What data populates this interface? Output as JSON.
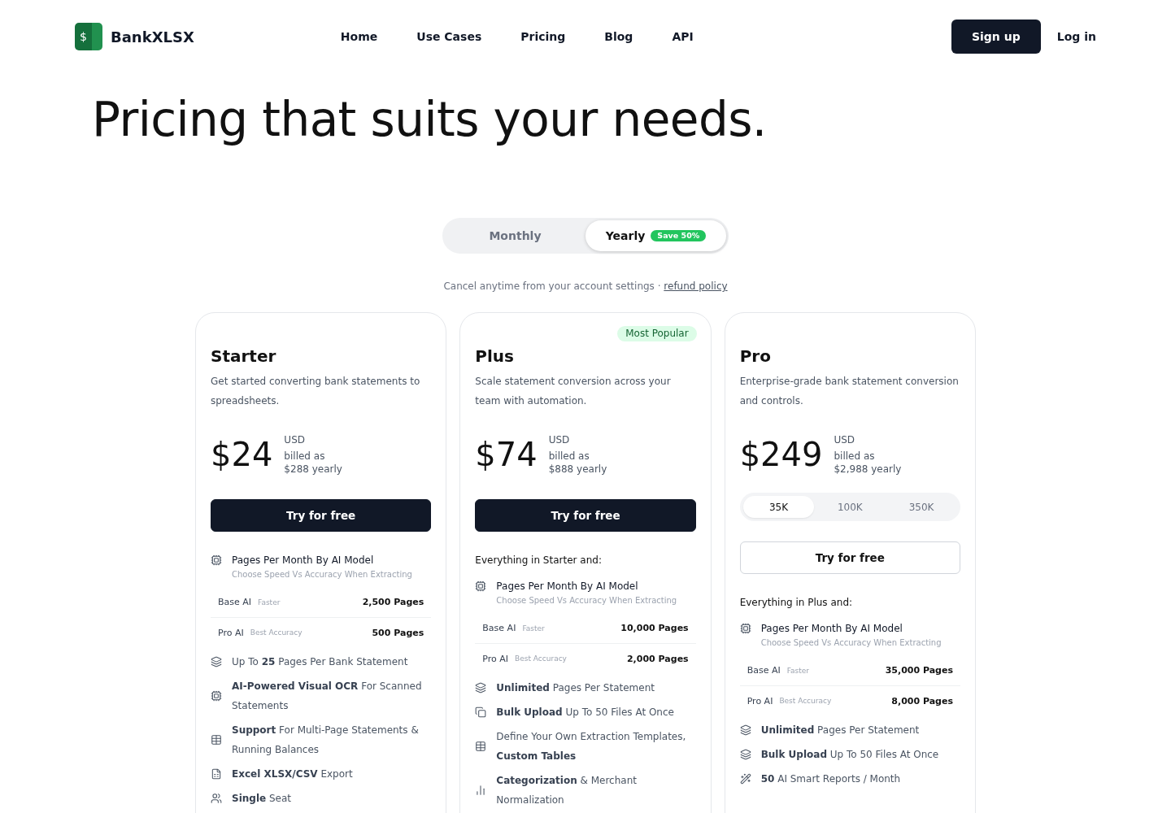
{
  "header": {
    "brand": {
      "mark": "$",
      "name": "BankXLSX"
    },
    "nav": [
      "Home",
      "Use Cases",
      "Pricing",
      "Blog",
      "API"
    ],
    "sign_up": "Sign up",
    "log_in": "Log in"
  },
  "hero": {
    "title": "Pricing that suits your needs."
  },
  "billing_toggle": {
    "options": [
      {
        "label": "Monthly",
        "selected": false
      },
      {
        "label": "Yearly",
        "selected": true,
        "badge": "Save 50%"
      }
    ]
  },
  "note": {
    "text": "Cancel anytime from your account settings ·",
    "link": "refund policy"
  },
  "plans": [
    {
      "name": "Starter",
      "description": "Get started converting bank statements to spreadsheets.",
      "price": {
        "amount": "$24",
        "currency": "USD",
        "billing": "billed as",
        "total": "$288 yearly"
      },
      "cta": {
        "label": "Try for free",
        "kind": "solid"
      },
      "model_feature": {
        "kind": "chip",
        "title": "Pages Per Month By AI Model",
        "subtitle": "Choose Speed Vs Accuracy When Extracting",
        "models": [
          {
            "name": "Base AI",
            "tag": "Faster",
            "pages": "2,500 Pages"
          },
          {
            "name": "Pro AI",
            "tag": "Best Accuracy",
            "pages": "500 Pages"
          }
        ]
      },
      "features": [
        {
          "kind": "layers",
          "text": "Up To **25** Pages Per Bank Statement"
        },
        {
          "kind": "chip",
          "text": "**AI-Powered Visual OCR** For Scanned Statements"
        },
        {
          "kind": "table",
          "text": "**Support** For Multi-Page Statements & Running Balances"
        },
        {
          "kind": "sheet",
          "text": "**Excel XLSX/CSV** Export"
        },
        {
          "kind": "users",
          "text": "**Single** Seat"
        }
      ]
    },
    {
      "name": "Plus",
      "badge": "Most Popular",
      "description": "Scale statement conversion across your team with automation.",
      "price": {
        "amount": "$74",
        "currency": "USD",
        "billing": "billed as",
        "total": "$888 yearly"
      },
      "cta": {
        "label": "Try for free",
        "kind": "solid"
      },
      "features_heading": "Everything in Starter and:",
      "model_feature": {
        "kind": "chip",
        "title": "Pages Per Month By AI Model",
        "subtitle": "Choose Speed Vs Accuracy When Extracting",
        "models": [
          {
            "name": "Base AI",
            "tag": "Faster",
            "pages": "10,000 Pages"
          },
          {
            "name": "Pro AI",
            "tag": "Best Accuracy",
            "pages": "2,000 Pages"
          }
        ]
      },
      "features": [
        {
          "kind": "layers",
          "text": "**Unlimited** Pages Per Statement"
        },
        {
          "kind": "copy",
          "text": "**Bulk Upload** Up To 50 Files At Once"
        },
        {
          "kind": "table",
          "text": "Define Your Own Extraction Templates, **Custom Tables**"
        },
        {
          "kind": "bars",
          "text": "**Categorization** & Merchant Normalization"
        }
      ]
    },
    {
      "name": "Pro",
      "description": "Enterprise-grade bank statement conversion and controls.",
      "price": {
        "amount": "$249",
        "currency": "USD",
        "billing": "billed as",
        "total": "$2,988 yearly"
      },
      "volume_options": [
        {
          "label": "35K",
          "selected": true
        },
        {
          "label": "100K",
          "selected": false
        },
        {
          "label": "350K",
          "selected": false
        }
      ],
      "cta": {
        "label": "Try for free",
        "kind": "outline"
      },
      "features_heading": "Everything in Plus and:",
      "model_feature": {
        "kind": "chip",
        "title": "Pages Per Month By AI Model",
        "subtitle": "Choose Speed Vs Accuracy When Extracting",
        "models": [
          {
            "name": "Base AI",
            "tag": "Faster",
            "pages": "35,000 Pages"
          },
          {
            "name": "Pro AI",
            "tag": "Best Accuracy",
            "pages": "8,000 Pages"
          }
        ]
      },
      "features": [
        {
          "kind": "layers",
          "text": "**Unlimited** Pages Per Statement"
        },
        {
          "kind": "layers",
          "text": "**Bulk Upload** Up To 50 Files At Once"
        },
        {
          "kind": "wand",
          "text": "**50** AI Smart Reports / Month"
        }
      ]
    }
  ]
}
